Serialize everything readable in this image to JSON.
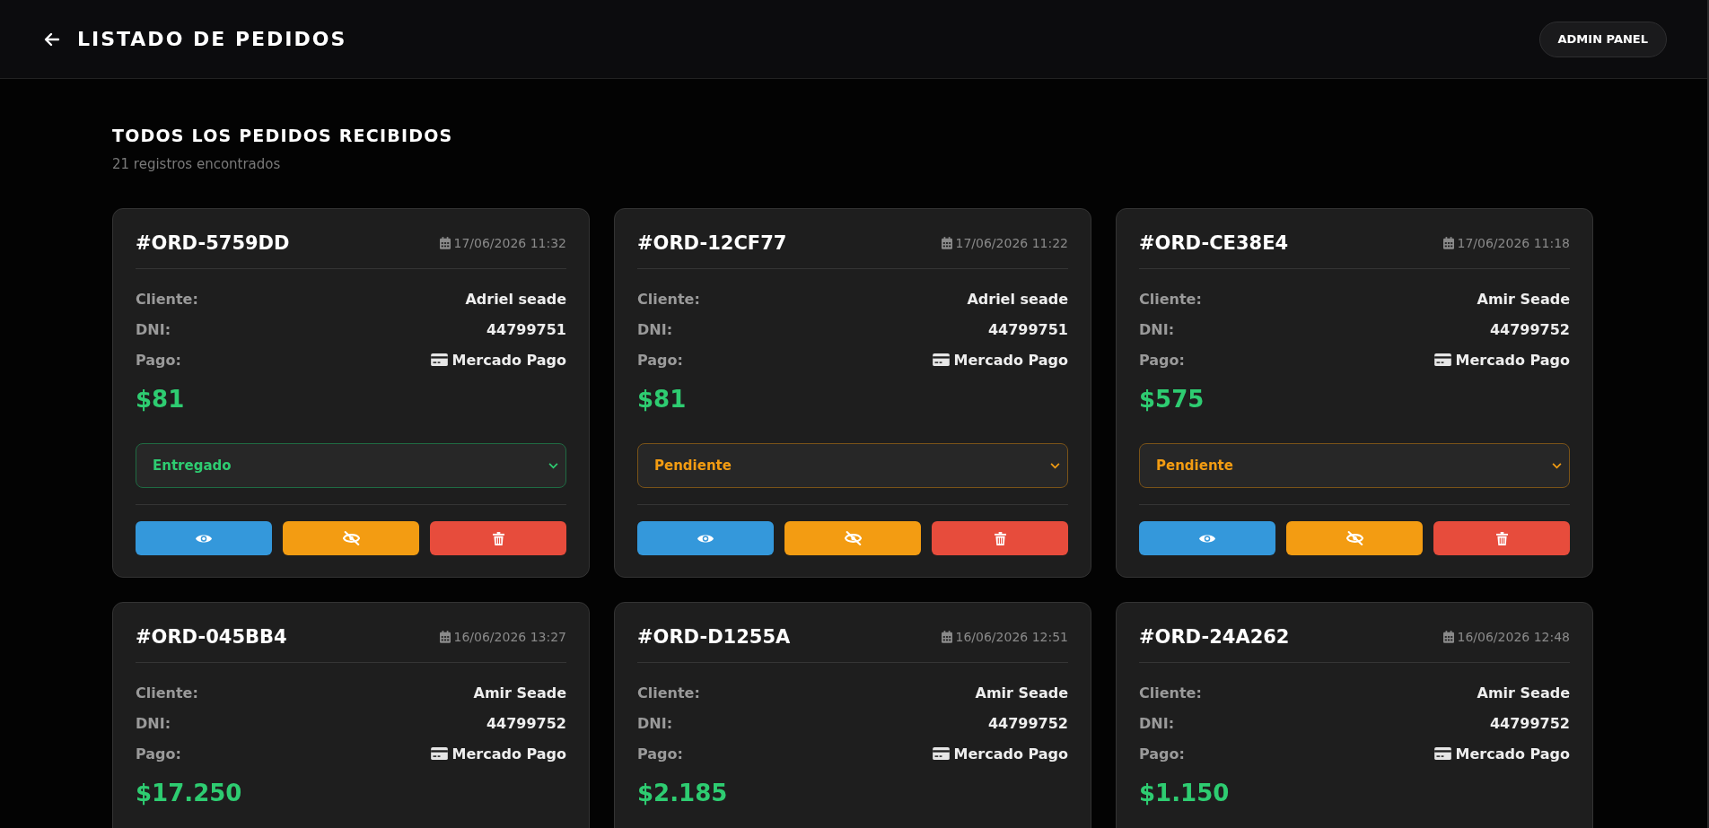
{
  "header": {
    "title": "LISTADO DE PEDIDOS",
    "admin_button": "ADMIN PANEL"
  },
  "section": {
    "title": "TODOS LOS PEDIDOS RECIBIDOS",
    "count": "21 registros encontrados"
  },
  "orders": [
    {
      "id": "#ORD-5759DD",
      "date": "17/06/2026 11:32",
      "fields": [
        {
          "kind": "client",
          "label": "Cliente:",
          "value": "Adriel seade"
        },
        {
          "kind": "dni",
          "label": "DNI:",
          "value": "44799751"
        },
        {
          "kind": "payment",
          "label": "Pago:",
          "value": "Mercado Pago"
        }
      ],
      "total": "$81",
      "status": {
        "label": "Entregado",
        "kind": "delivered"
      }
    },
    {
      "id": "#ORD-12CF77",
      "date": "17/06/2026 11:22",
      "fields": [
        {
          "kind": "client",
          "label": "Cliente:",
          "value": "Adriel seade"
        },
        {
          "kind": "dni",
          "label": "DNI:",
          "value": "44799751"
        },
        {
          "kind": "payment",
          "label": "Pago:",
          "value": "Mercado Pago"
        }
      ],
      "total": "$81",
      "status": {
        "label": "Pendiente",
        "kind": "pending"
      }
    },
    {
      "id": "#ORD-CE38E4",
      "date": "17/06/2026 11:18",
      "fields": [
        {
          "kind": "client",
          "label": "Cliente:",
          "value": "Amir Seade"
        },
        {
          "kind": "dni",
          "label": "DNI:",
          "value": "44799752"
        },
        {
          "kind": "payment",
          "label": "Pago:",
          "value": "Mercado Pago"
        }
      ],
      "total": "$575",
      "status": {
        "label": "Pendiente",
        "kind": "pending"
      }
    },
    {
      "id": "#ORD-045BB4",
      "date": "16/06/2026 13:27",
      "fields": [
        {
          "kind": "client",
          "label": "Cliente:",
          "value": "Amir Seade"
        },
        {
          "kind": "dni",
          "label": "DNI:",
          "value": "44799752"
        },
        {
          "kind": "payment",
          "label": "Pago:",
          "value": "Mercado Pago"
        }
      ],
      "total": "$17.250"
    },
    {
      "id": "#ORD-D1255A",
      "date": "16/06/2026 12:51",
      "fields": [
        {
          "kind": "client",
          "label": "Cliente:",
          "value": "Amir Seade"
        },
        {
          "kind": "dni",
          "label": "DNI:",
          "value": "44799752"
        },
        {
          "kind": "payment",
          "label": "Pago:",
          "value": "Mercado Pago"
        }
      ],
      "total": "$2.185"
    },
    {
      "id": "#ORD-24A262",
      "date": "16/06/2026 12:48",
      "fields": [
        {
          "kind": "client",
          "label": "Cliente:",
          "value": "Amir Seade"
        },
        {
          "kind": "dni",
          "label": "DNI:",
          "value": "44799752"
        },
        {
          "kind": "payment",
          "label": "Pago:",
          "value": "Mercado Pago"
        }
      ],
      "total": "$1.150"
    }
  ]
}
